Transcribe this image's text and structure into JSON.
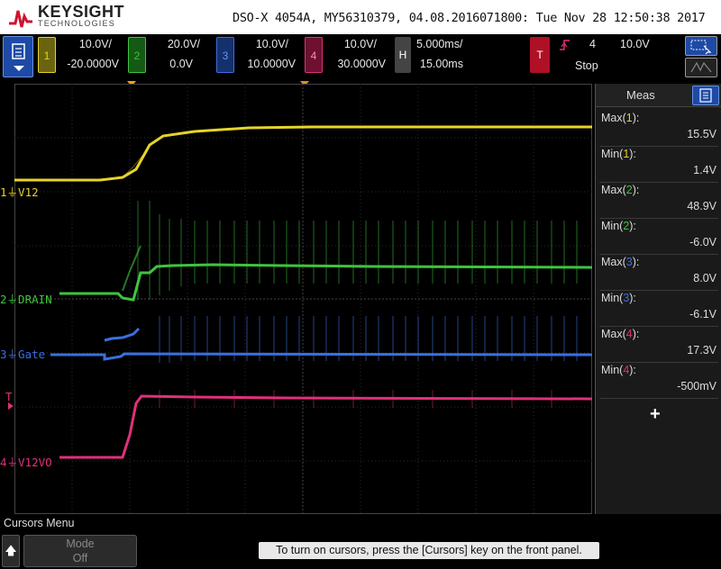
{
  "header": {
    "brand": "KEYSIGHT",
    "brand_sub": "TECHNOLOGIES",
    "info": "DSO-X 4054A, MY56310379, 04.08.2016071800: Tue Nov 28 12:50:38 2017"
  },
  "toolbar": {
    "channels": [
      {
        "num": "1",
        "scale": "10.0V/",
        "offset": "-20.0000V",
        "color": "#e6d428"
      },
      {
        "num": "2",
        "scale": "20.0V/",
        "offset": "0.0V",
        "color": "#3fc43f"
      },
      {
        "num": "3",
        "scale": "10.0V/",
        "offset": "10.0000V",
        "color": "#3b6fe0"
      },
      {
        "num": "4",
        "scale": "10.0V/",
        "offset": "30.0000V",
        "color": "#e0307a"
      }
    ],
    "horizontal": {
      "badge": "H",
      "timebase": "5.000ms/",
      "delay": "15.00ms"
    },
    "trigger": {
      "badge": "T",
      "edge_icon": "rising-edge-icon",
      "source": "4",
      "level": "10.0V",
      "status": "Stop"
    }
  },
  "channel_labels": {
    "ch1": {
      "num": "1",
      "name": "V12"
    },
    "ch2": {
      "num": "2",
      "name": "DRAIN"
    },
    "ch3": {
      "num": "3",
      "name": "Gate"
    },
    "ch4": {
      "num": "4",
      "name": "V12VO"
    },
    "trigger_marker": "T"
  },
  "meas": {
    "title": "Meas",
    "items": [
      {
        "label": "Max(",
        "ch": "1",
        "value": "15.5V",
        "color": "#e6d428"
      },
      {
        "label": "Min(",
        "ch": "1",
        "value": "1.4V",
        "color": "#e6d428"
      },
      {
        "label": "Max(",
        "ch": "2",
        "value": "48.9V",
        "color": "#3fc43f"
      },
      {
        "label": "Min(",
        "ch": "2",
        "value": "-6.0V",
        "color": "#3fc43f"
      },
      {
        "label": "Max(",
        "ch": "3",
        "value": "8.0V",
        "color": "#3b6fe0"
      },
      {
        "label": "Min(",
        "ch": "3",
        "value": "-6.1V",
        "color": "#3b6fe0"
      },
      {
        "label": "Max(",
        "ch": "4",
        "value": "17.3V",
        "color": "#e0307a"
      },
      {
        "label": "Min(",
        "ch": "4",
        "value": "-500mV",
        "color": "#e0307a"
      }
    ],
    "add_label": "+"
  },
  "bottom": {
    "menu_title": "Cursors Menu",
    "back_icon": "up-arrow-icon",
    "mode_label": "Mode",
    "mode_value": "Off",
    "hint": "To turn on cursors, press the [Cursors] key on the front panel."
  },
  "colors": {
    "ch1": "#e6d428",
    "ch2": "#3fc43f",
    "ch3": "#3b6fe0",
    "ch4": "#e0307a",
    "accent": "#1d4aa6",
    "trigger_marker": "#f0a020"
  }
}
